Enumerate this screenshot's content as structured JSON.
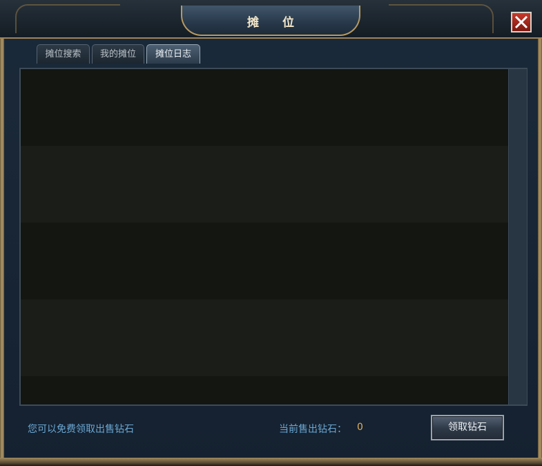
{
  "window": {
    "title": "摊 位",
    "close_icon": "close-icon"
  },
  "tabs": [
    {
      "label": "摊位搜索",
      "active": false
    },
    {
      "label": "我的摊位",
      "active": false
    },
    {
      "label": "摊位日志",
      "active": true
    }
  ],
  "log": {
    "rows": [
      "",
      "",
      "",
      "",
      ""
    ]
  },
  "footer": {
    "notice": "您可以免费领取出售钻石",
    "sold_label": "当前售出钻石：",
    "sold_value": "0",
    "claim_button": "领取钻石"
  },
  "colors": {
    "accent_gold": "#b79a63",
    "info_text": "#6aa8d4",
    "value_text": "#e0b062",
    "close_red": "#c6392b"
  }
}
